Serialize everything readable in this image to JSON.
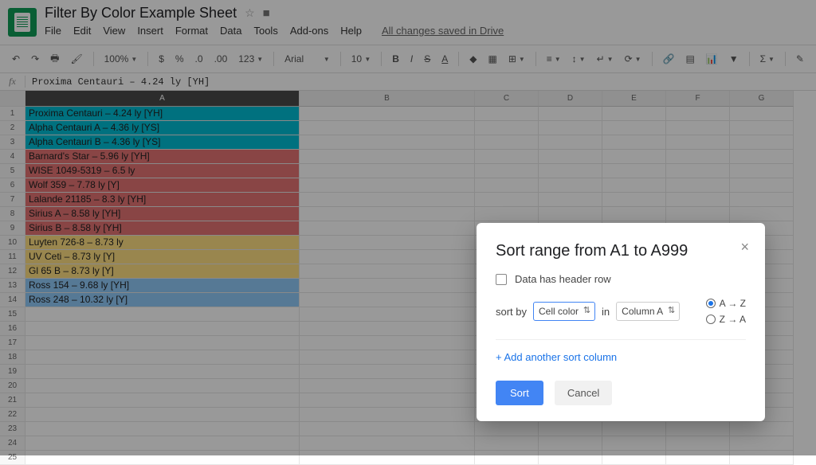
{
  "header": {
    "doc_title": "Filter By Color Example Sheet",
    "menus": [
      "File",
      "Edit",
      "View",
      "Insert",
      "Format",
      "Data",
      "Tools",
      "Add-ons",
      "Help"
    ],
    "saved_msg": "All changes saved in Drive"
  },
  "toolbar": {
    "zoom": "100%",
    "currency": "$",
    "percent": "%",
    "dec_less": ".0",
    "dec_more": ".00",
    "numfmt": "123",
    "font": "Arial",
    "size": "10"
  },
  "fx": {
    "value": "Proxima Centauri – 4.24 ly [YH]"
  },
  "columns": [
    "A",
    "B",
    "C",
    "D",
    "E",
    "F",
    "G"
  ],
  "rows": [
    {
      "n": 1,
      "txt": "Proxima Centauri – 4.24 ly [YH]",
      "color": "teal"
    },
    {
      "n": 2,
      "txt": "Alpha Centauri A – 4.36 ly [YS]",
      "color": "teal"
    },
    {
      "n": 3,
      "txt": "Alpha Centauri B – 4.36 ly [YS]",
      "color": "teal"
    },
    {
      "n": 4,
      "txt": "Barnard's Star – 5.96 ly [YH]",
      "color": "red"
    },
    {
      "n": 5,
      "txt": "WISE 1049-5319 – 6.5 ly",
      "color": "red"
    },
    {
      "n": 6,
      "txt": "Wolf 359 – 7.78 ly [Y]",
      "color": "red"
    },
    {
      "n": 7,
      "txt": "Lalande 21185 – 8.3 ly [YH]",
      "color": "red"
    },
    {
      "n": 8,
      "txt": "Sirius A – 8.58 ly [YH]",
      "color": "red"
    },
    {
      "n": 9,
      "txt": "Sirius B – 8.58 ly [YH]",
      "color": "red"
    },
    {
      "n": 10,
      "txt": "Luyten 726-8 – 8.73 ly",
      "color": "yel"
    },
    {
      "n": 11,
      "txt": "UV Ceti – 8.73 ly [Y]",
      "color": "yel"
    },
    {
      "n": 12,
      "txt": "Gl 65 B – 8.73 ly [Y]",
      "color": "yel"
    },
    {
      "n": 13,
      "txt": "Ross 154 – 9.68 ly [YH]",
      "color": "blue"
    },
    {
      "n": 14,
      "txt": "Ross 248 – 10.32 ly [Y]",
      "color": "blue"
    },
    {
      "n": 15,
      "txt": "",
      "color": ""
    },
    {
      "n": 16,
      "txt": "",
      "color": ""
    },
    {
      "n": 17,
      "txt": "",
      "color": ""
    },
    {
      "n": 18,
      "txt": "",
      "color": ""
    },
    {
      "n": 19,
      "txt": "",
      "color": ""
    },
    {
      "n": 20,
      "txt": "",
      "color": ""
    },
    {
      "n": 21,
      "txt": "",
      "color": ""
    },
    {
      "n": 22,
      "txt": "",
      "color": ""
    },
    {
      "n": 23,
      "txt": "",
      "color": ""
    },
    {
      "n": 24,
      "txt": "",
      "color": ""
    },
    {
      "n": 25,
      "txt": "",
      "color": ""
    }
  ],
  "dialog": {
    "title": "Sort range from A1 to A999",
    "header_row_label": "Data has header row",
    "sortby_label": "sort by",
    "sortby_value": "Cell color",
    "in_label": "in",
    "column_value": "Column A",
    "radio_az": "A → Z",
    "radio_za": "Z → A",
    "add_link": "+ Add another sort column",
    "ok": "Sort",
    "cancel": "Cancel"
  }
}
